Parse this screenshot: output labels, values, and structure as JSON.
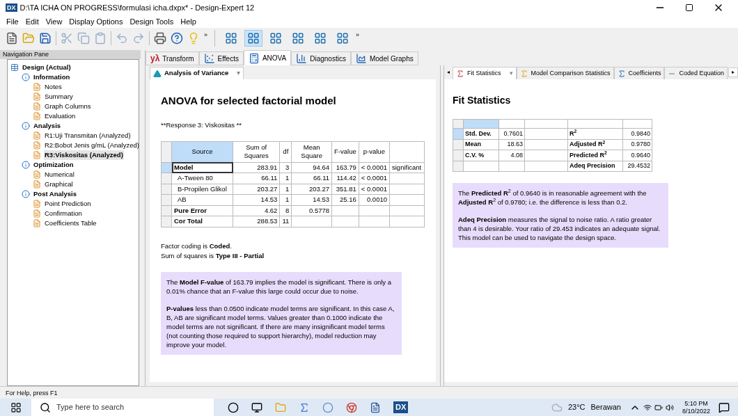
{
  "window": {
    "logo": "DX",
    "title": "D:\\TA ICHA ON PROGRESS\\formulasi icha.dxpx* - Design-Expert 12"
  },
  "menu": [
    "File",
    "Edit",
    "View",
    "Display Options",
    "Design Tools",
    "Help"
  ],
  "toolbar_overflow": [
    "»",
    "»"
  ],
  "layout_buttons": [
    {
      "selected": false
    },
    {
      "selected": true
    },
    {
      "selected": false
    },
    {
      "selected": false
    },
    {
      "selected": false
    },
    {
      "selected": false
    }
  ],
  "nav": {
    "title": "Navigation Pane",
    "tree": [
      {
        "label": "Design (Actual)",
        "kind": "root",
        "selected": false,
        "children": [
          {
            "label": "Information",
            "kind": "group",
            "selected": false,
            "children": [
              {
                "label": "Notes",
                "kind": "item",
                "selected": false
              },
              {
                "label": "Summary",
                "kind": "item",
                "selected": false
              },
              {
                "label": "Graph Columns",
                "kind": "item",
                "selected": false
              },
              {
                "label": "Evaluation",
                "kind": "item",
                "selected": false
              }
            ]
          },
          {
            "label": "Analysis",
            "kind": "group",
            "selected": false,
            "children": [
              {
                "label": "R1:Uji Transmitan (Analyzed)",
                "kind": "item",
                "selected": false
              },
              {
                "label": "R2:Bobot Jenis g/mL (Analyzed)",
                "kind": "item",
                "selected": false
              },
              {
                "label": "R3:Viskositas  (Analyzed)",
                "kind": "item",
                "selected": true
              }
            ]
          },
          {
            "label": "Optimization",
            "kind": "group",
            "selected": false,
            "children": [
              {
                "label": "Numerical",
                "kind": "item",
                "selected": false
              },
              {
                "label": "Graphical",
                "kind": "item",
                "selected": false
              }
            ]
          },
          {
            "label": "Post Analysis",
            "kind": "group",
            "selected": false,
            "children": [
              {
                "label": "Point Prediction",
                "kind": "item",
                "selected": false
              },
              {
                "label": "Confirmation",
                "kind": "item",
                "selected": false
              },
              {
                "label": "Coefficients Table",
                "kind": "item",
                "selected": false
              }
            ]
          }
        ]
      }
    ]
  },
  "tabs": [
    {
      "label": "Transform",
      "icon_text": "yλ",
      "selected": false
    },
    {
      "label": "Effects",
      "selected": false
    },
    {
      "label": "ANOVA",
      "selected": true
    },
    {
      "label": "Diagnostics",
      "selected": false
    },
    {
      "label": "Model Graphs",
      "selected": false
    }
  ],
  "anova": {
    "subtab": "Analysis of Variance",
    "subtab_menu": "▾",
    "heading": "ANOVA for selected factorial model",
    "response": "**Response 3: Viskositas **",
    "columns": [
      "Source",
      "Sum of Squares",
      "df",
      "Mean Square",
      "F-value",
      "p-value"
    ],
    "rows": [
      {
        "kind": "bold",
        "selected": true,
        "cells": [
          "Model",
          "283.91",
          "3",
          "94.64",
          "163.79",
          "< 0.0001",
          "significant"
        ]
      },
      {
        "kind": "term",
        "selected": false,
        "cells": [
          "A-Tween 80",
          "66.11",
          "1",
          "66.11",
          "114.42",
          "< 0.0001",
          ""
        ]
      },
      {
        "kind": "term",
        "selected": false,
        "cells": [
          "B-Propilen Glikol",
          "203.27",
          "1",
          "203.27",
          "351.81",
          "< 0.0001",
          ""
        ]
      },
      {
        "kind": "term",
        "selected": false,
        "cells": [
          "AB",
          "14.53",
          "1",
          "14.53",
          "25.16",
          "0.0010",
          ""
        ]
      },
      {
        "kind": "bold",
        "selected": false,
        "cells": [
          "Pure Error",
          "4.62",
          "8",
          "0.5778",
          "",
          "",
          ""
        ]
      },
      {
        "kind": "bold",
        "selected": false,
        "cells": [
          "Cor Total",
          "288.53",
          "11",
          "",
          "",
          "",
          ""
        ]
      }
    ],
    "notes": [
      "Factor coding is **Coded**.",
      "Sum of squares is **Type III - Partial**"
    ],
    "info": [
      "The **Model F-value** of 163.79 implies the model is significant. There is only a 0.01% chance that an F-value this large could occur due to noise.",
      "**P-values** less than 0.0500 indicate model terms are significant. In this case A, B, AB are significant model terms. Values greater than 0.1000 indicate the model terms are not significant. If there are many insignificant model terms (not counting those required to support hierarchy), model reduction may improve your model."
    ]
  },
  "fit": {
    "scroll_left": "◂",
    "scroll_right": "▸",
    "subtab_menu": "▾",
    "subtabs": [
      {
        "label": "Fit Statistics",
        "selected": true
      },
      {
        "label": "Model Comparison Statistics",
        "selected": false
      },
      {
        "label": "Coefficients",
        "selected": false
      },
      {
        "label": "Coded Equation",
        "selected": false
      }
    ],
    "heading": "Fit Statistics",
    "rows": [
      {
        "selected": true,
        "cells": [
          "Std. Dev.",
          "0.7601",
          "",
          "R$^{2}$",
          "0.9840"
        ]
      },
      {
        "selected": false,
        "cells": [
          "Mean",
          "18.63",
          "",
          "Adjusted R$^{2}$",
          "0.9780"
        ]
      },
      {
        "selected": false,
        "cells": [
          "C.V. %",
          "4.08",
          "",
          "Predicted R$^{2}$",
          "0.9640"
        ]
      },
      {
        "selected": false,
        "cells": [
          "",
          "",
          "",
          "Adeq Precision",
          "29.4532"
        ]
      }
    ],
    "info": [
      "The **Predicted R**$^{2}$ of 0.9640 is in reasonable agreement with the **Adjusted R**$^{2}$ of 0.9780; i.e. the difference is less than 0.2.",
      "**Adeq Precision** measures the signal to noise ratio. A ratio greater than 4 is desirable. Your ratio of 29.453 indicates an adequate signal. This model can be used to navigate the design space."
    ]
  },
  "status_bar": "For Help, press F1",
  "taskbar": {
    "search_placeholder": "Type here to search",
    "app_logo": "DX",
    "temperature": "23°C",
    "weather": "Berawan",
    "time": "5:10 PM",
    "date": "8/10/2022"
  }
}
